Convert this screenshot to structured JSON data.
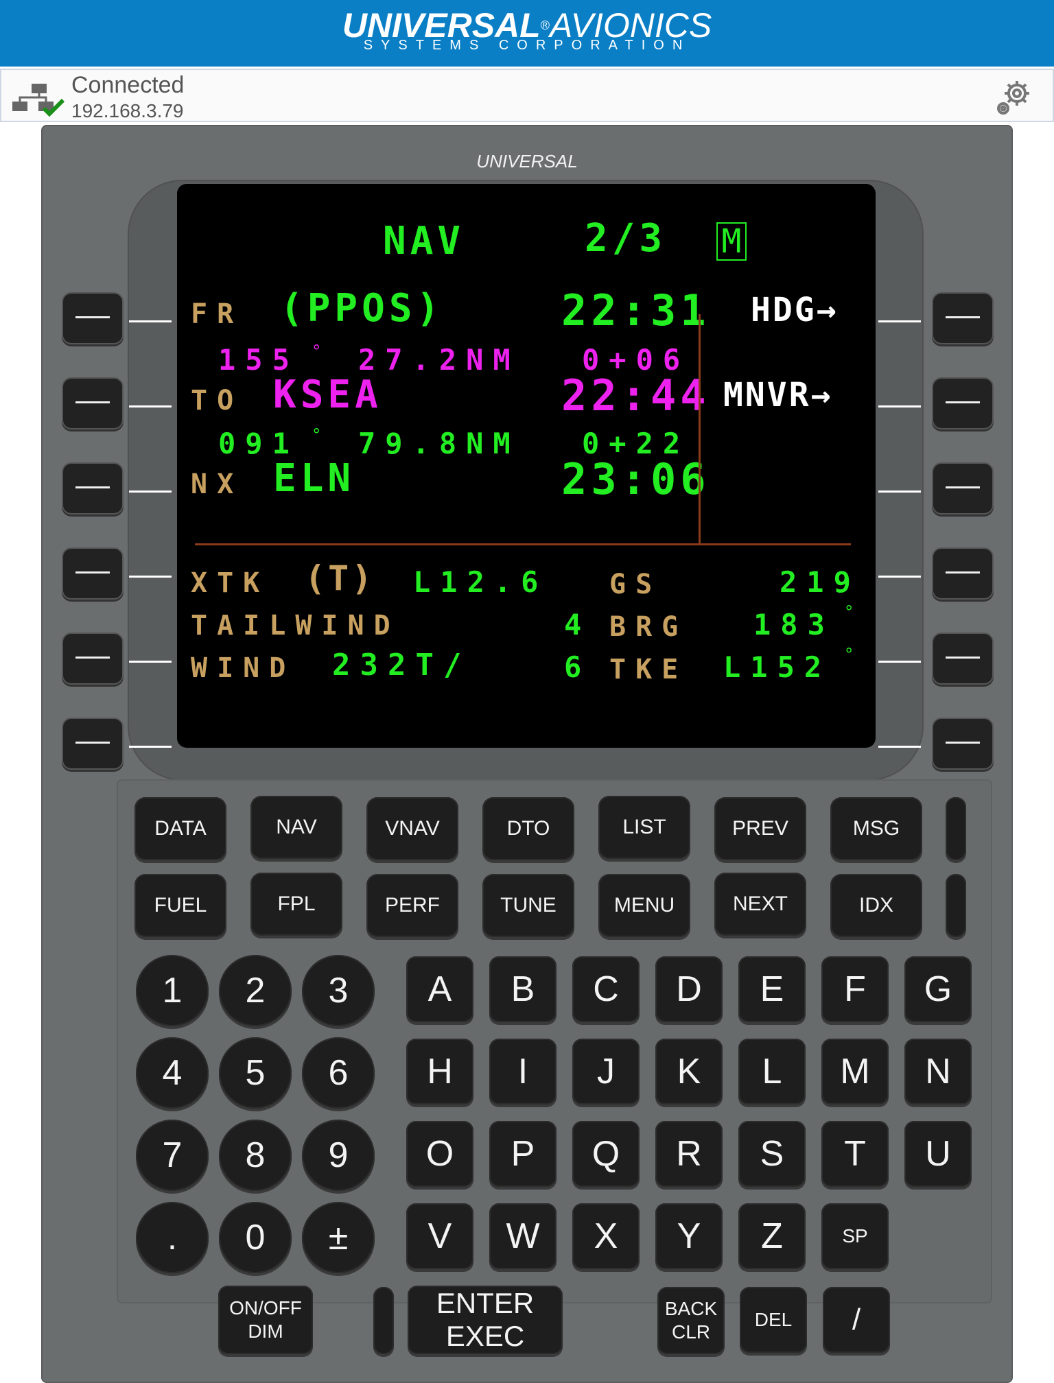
{
  "header": {
    "brand_bold": "UNIVERSAL",
    "brand_light": "AVIONICS",
    "registered": "®",
    "subtitle": "SYSTEMS CORPORATION"
  },
  "status": {
    "connection": "Connected",
    "ip": "192.168.3.79",
    "network_icon": "network-connected-icon",
    "settings_icon": "gear-icon"
  },
  "device": {
    "brand": "UNIVERSAL"
  },
  "screen": {
    "title": "NAV",
    "page": "2/3",
    "mode_box": "M",
    "fr_label": "FR",
    "fr_value": "(PPOS)",
    "fr_time": "22:31",
    "leg1_brg": "155",
    "leg1_dist": "27.2NM",
    "leg1_ete": "0+06",
    "to_label": "TO",
    "to_value": "KSEA",
    "to_time": "22:44",
    "leg2_brg": "091",
    "leg2_dist": "79.8NM",
    "leg2_ete": "0+22",
    "nx_label": "NX",
    "nx_value": "ELN",
    "nx_time": "23:06",
    "rsk1": "HDG→",
    "rsk2": "MNVR→",
    "xtk_label": "XTK",
    "xtk_mode": "(T)",
    "xtk_value": "L12.6",
    "gs_label": "GS",
    "gs_value": "219",
    "tailwind_label": "TAILWIND",
    "tailwind_value": "4",
    "brg_label": "BRG",
    "brg_value": "183",
    "wind_label": "WIND",
    "wind_dir": "232T/",
    "wind_speed": "6",
    "tke_label": "TKE",
    "tke_value": "L152",
    "degree": "°"
  },
  "function_keys": {
    "row1": [
      "DATA",
      "NAV",
      "VNAV",
      "DTO",
      "LIST",
      "PREV",
      "MSG"
    ],
    "row2": [
      "FUEL",
      "FPL",
      "PERF",
      "TUNE",
      "MENU",
      "NEXT",
      "IDX"
    ]
  },
  "number_keys": [
    "1",
    "2",
    "3",
    "4",
    "5",
    "6",
    "7",
    "8",
    "9",
    ".",
    "0",
    "±"
  ],
  "letter_keys": [
    "A",
    "B",
    "C",
    "D",
    "E",
    "F",
    "G",
    "H",
    "I",
    "J",
    "K",
    "L",
    "M",
    "N",
    "O",
    "P",
    "Q",
    "R",
    "S",
    "T",
    "U",
    "V",
    "W",
    "X",
    "Y",
    "Z",
    "SP"
  ],
  "bottom_keys": {
    "onoff_line1": "ON/OFF",
    "onoff_line2": "DIM",
    "enter_line1": "ENTER",
    "enter_line2": "EXEC",
    "back_line1": "BACK",
    "back_line2": "CLR",
    "del": "DEL",
    "slash": "/"
  },
  "colors": {
    "header_blue": "#0a7fc6",
    "screen_green": "#22ee22",
    "screen_magenta": "#ee22ee",
    "screen_label": "#c8a060"
  }
}
